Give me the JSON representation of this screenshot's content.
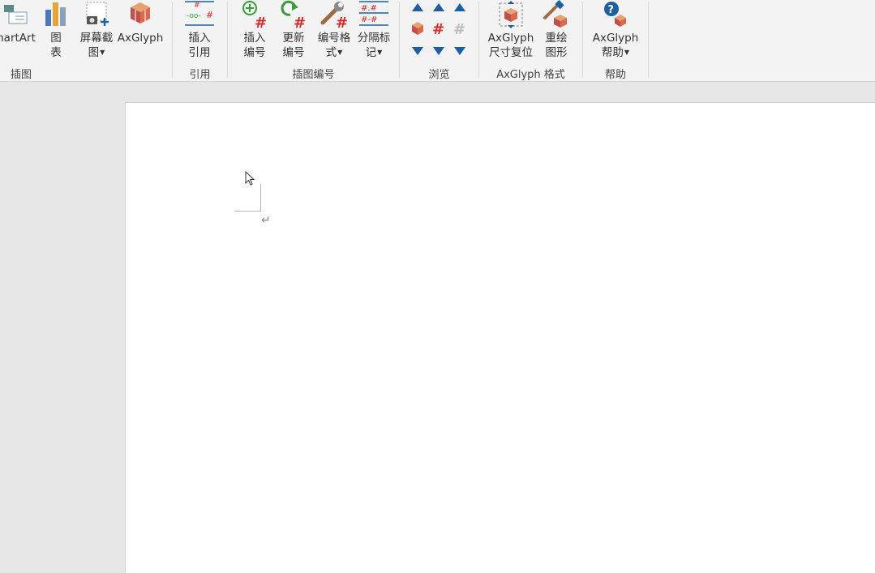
{
  "ribbon": {
    "groups": {
      "illustrations": {
        "label": "插图",
        "smartart": "nartArt",
        "chart": [
          "图",
          "表"
        ],
        "screenshot": [
          "屏幕截",
          "图"
        ],
        "axglyph": "AxGlyph"
      },
      "citation": {
        "label": "引用",
        "insert_citation": [
          "插入",
          "引用"
        ]
      },
      "numbering": {
        "label": "插图编号",
        "insert_number": [
          "插入",
          "编号"
        ],
        "update_number": [
          "更新",
          "编号"
        ],
        "number_format": [
          "编号格",
          "式"
        ],
        "separator_mark": [
          "分隔标",
          "记"
        ]
      },
      "browse": {
        "label": "浏览"
      },
      "axglyph_format": {
        "label": "AxGlyph 格式",
        "reset_size": [
          "AxGlyph",
          "尺寸复位"
        ],
        "redraw": [
          "重绘",
          "图形"
        ]
      },
      "help": {
        "label": "帮助",
        "axglyph_help": [
          "AxGlyph",
          "帮助"
        ]
      }
    }
  },
  "document": {
    "paragraph_mark": "↵"
  },
  "colors": {
    "accent_red": "#d22b2b",
    "accent_blue": "#1d5fa0",
    "accent_green": "#3b9a3b"
  }
}
